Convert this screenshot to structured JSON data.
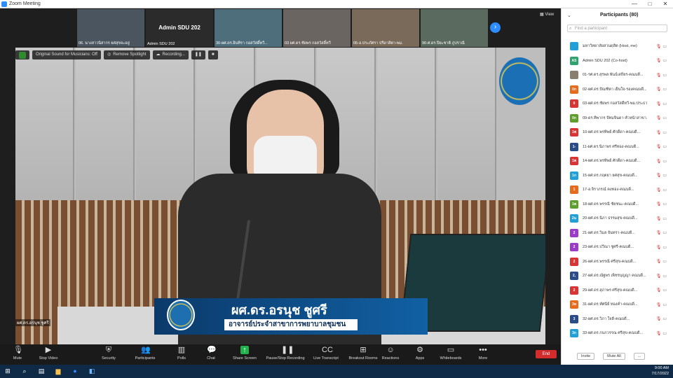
{
  "window": {
    "title": "Zoom Meeting",
    "controls": [
      "—",
      "□",
      "✕"
    ]
  },
  "gallery": {
    "tiles": [
      {
        "label": "06. นางสาวนิสากร ยศสุขจะอยู่",
        "kind": "video"
      },
      {
        "label": "Admin SDU 202",
        "big_name": "Admin SDU 202",
        "kind": "name"
      },
      {
        "label": "30-ผศ.ดร.อินทิรา กอสวัสดิ์ทวี...",
        "kind": "video"
      },
      {
        "label": "03 ผศ.ดร.ชัยพร กอสวัสดิ์ทวี",
        "kind": "video"
      },
      {
        "label": "05-อ.ประภัศรา ปรีดาสิตา-พม.",
        "kind": "video"
      },
      {
        "label": "90-ศ.ดร.ปิยะชาติ ภู่ปราณี",
        "kind": "video"
      }
    ],
    "next_button": "›",
    "view_label": "View"
  },
  "top_indicators": {
    "original_sound": "Original Sound for Musicians: Off",
    "remove_spotlight": "Remove Spotlight",
    "recording": "Recording..."
  },
  "caption": {
    "name": "ผศ.ดร.อรนุช ชูศรี",
    "role": "อาจารย์ประจำสาขาการพยาบาลชุมชน"
  },
  "active_speaker_label": "ผศ.ดร.อรนุช ชูศรี",
  "toolbar": {
    "items": [
      {
        "label": "Mute",
        "icon": "mic-icon"
      },
      {
        "label": "Stop Video",
        "icon": "video-icon"
      },
      {
        "label": "Security",
        "icon": "shield-icon"
      },
      {
        "label": "Participants",
        "icon": "people-icon",
        "count": "80"
      },
      {
        "label": "Polls",
        "icon": "poll-icon"
      },
      {
        "label": "Chat",
        "icon": "chat-icon",
        "badge": "1"
      },
      {
        "label": "Share Screen",
        "icon": "share-icon"
      },
      {
        "label": "Pause/Stop Recording",
        "icon": "record-icon"
      },
      {
        "label": "Live Transcript",
        "icon": "cc-icon"
      },
      {
        "label": "Breakout Rooms",
        "icon": "breakout-icon"
      },
      {
        "label": "Reactions",
        "icon": "reaction-icon"
      },
      {
        "label": "Apps",
        "icon": "apps-icon"
      },
      {
        "label": "Whiteboards",
        "icon": "whiteboard-icon"
      },
      {
        "label": "More",
        "icon": "more-icon"
      }
    ],
    "end_label": "End"
  },
  "participants": {
    "title": "Participants (80)",
    "search_placeholder": "Find a participant",
    "rows": [
      {
        "avatar": "",
        "color": "#21a0d8",
        "name": "มหาวิทยาลัยสวนดุสิต (Host, me)"
      },
      {
        "avatar": "AS",
        "color": "#2fa36b",
        "name": "Admin SDU 202 (Co-host)"
      },
      {
        "avatar": "",
        "color": "#8a7e6e",
        "name": "01-รศ.ดร.สุรพล พันธ์เสถียร-คณบดี..."
      },
      {
        "avatar": "0ก",
        "color": "#e66b1c",
        "name": "02-ผศ.ดร.ปัณฑิตา เย็นใจ-รองคณบดี..."
      },
      {
        "avatar": "0",
        "color": "#d93434",
        "name": "03-ผศ.ดร.ชัยพร กอสวัสดิ์ทวี-พม.ประธานหลักสูตร..."
      },
      {
        "avatar": "0ก",
        "color": "#5e9e2c",
        "name": "09-ดร.ทิพากร ปัทมจินดา-หัวหน้าสาขา..."
      },
      {
        "avatar": "1พ",
        "color": "#d93434",
        "name": "10-ผศ.ดร.พรทิพย์ ศักดิ์ดา-คณบดี..."
      },
      {
        "avatar": "1-",
        "color": "#2a4d8a",
        "name": "11-ผศ.ดร.นิภาพร ศรีทอง-คณบดี..."
      },
      {
        "avatar": "1พ",
        "color": "#d93434",
        "name": "14-ผศ.ดร.พรทิพย์ ศักดิ์ดา-คณบดี..."
      },
      {
        "avatar": "1ก",
        "color": "#21a0d8",
        "name": "15-ผศ.ดร.กฤตยา ยศสุข-คณบดี..."
      },
      {
        "avatar": "1",
        "color": "#e66b1c",
        "name": "17-อ.จิราภรณ์ คงทอง-คณบดี..."
      },
      {
        "avatar": "1พ",
        "color": "#5e9e2c",
        "name": "18-ผศ.ดร.พรรณี ชัยชนะ-คณบดี..."
      },
      {
        "avatar": "2น",
        "color": "#21a0d8",
        "name": "20-ผศ.ดร.นิภา ธรรมสุข-คณบดี..."
      },
      {
        "avatar": "2",
        "color": "#9b3cc9",
        "name": "21-ผศ.ดร.วิมล จันทรา-คณบดี..."
      },
      {
        "avatar": "2",
        "color": "#9b3cc9",
        "name": "23-ผศ.ดร.ปวีณา ชูศรี-คณบดี..."
      },
      {
        "avatar": "2",
        "color": "#d93434",
        "name": "26-ผศ.ดร.พรรณี ศรีสุข-คณบดี..."
      },
      {
        "avatar": "2,",
        "color": "#2a4d8a",
        "name": "27-ผศ.ดร.ณัฐพร เพ็ชรบุญญา คณบดี..."
      },
      {
        "avatar": "2",
        "color": "#d93434",
        "name": "29-ผศ.ดร.สุภาพร ศรีสุข-คณบดี..."
      },
      {
        "avatar": "3ท",
        "color": "#e66b1c",
        "name": "31-ผศ.ดร.ทัศนีย์ ทองคำ-คณบดี..."
      },
      {
        "avatar": "3",
        "color": "#2a4d8a",
        "name": "32-ผศ.ดร.วิภา ใจดี-คณบดี..."
      },
      {
        "avatar": "3ก",
        "color": "#21a0d8",
        "name": "33-ผศ.ดร.กนกวรรณ ศรีสุข-คณบดี..."
      }
    ],
    "invite_label": "Invite",
    "mute_all_label": "Mute All",
    "more_label": "..."
  },
  "taskbar": {
    "time": "9:00 AM",
    "date": "7/17/2022"
  }
}
